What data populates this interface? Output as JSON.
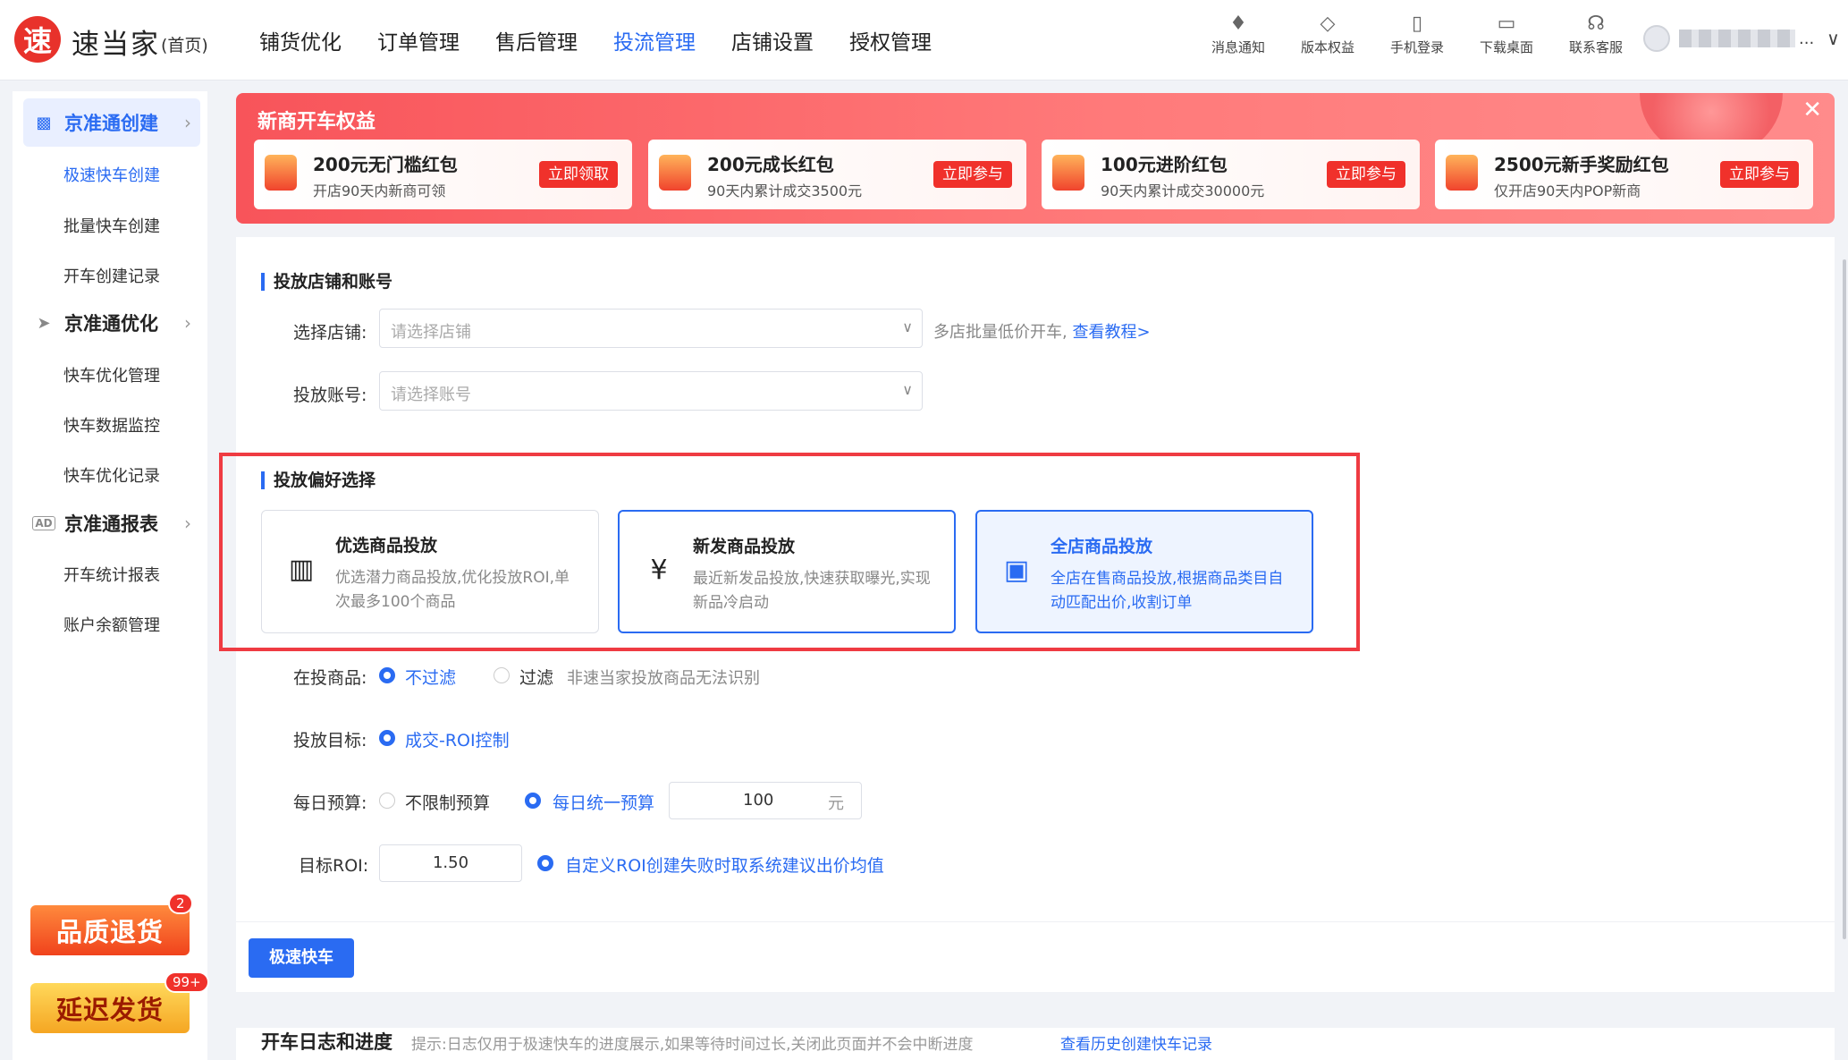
{
  "header": {
    "logo_char": "速",
    "brand": "速当家",
    "brand_sub": "(首页)",
    "nav": [
      {
        "label": "铺货优化"
      },
      {
        "label": "订单管理"
      },
      {
        "label": "售后管理"
      },
      {
        "label": "投流管理",
        "active": true
      },
      {
        "label": "店铺设置"
      },
      {
        "label": "授权管理"
      }
    ],
    "tools": [
      {
        "icon": "bell-icon",
        "glyph": "🔔",
        "label": "消息通知"
      },
      {
        "icon": "diamond-icon",
        "glyph": "◇",
        "label": "版本权益"
      },
      {
        "icon": "phone-icon",
        "glyph": "▯",
        "label": "手机登录"
      },
      {
        "icon": "monitor-icon",
        "glyph": "▭",
        "label": "下载桌面"
      },
      {
        "icon": "headset-icon",
        "glyph": "☊",
        "label": "联系客服"
      }
    ],
    "user": {
      "dots": "...",
      "caret": "∨"
    }
  },
  "sidebar": {
    "groups": [
      {
        "label": "京准通创建",
        "icon": "chart-icon",
        "glyph": "▟",
        "active": true,
        "chevron": "›"
      },
      {
        "label": "京准通优化",
        "icon": "send-icon",
        "glyph": "➤",
        "chevron": "›"
      },
      {
        "label": "京准通报表",
        "icon": "ad-icon",
        "glyph": "AD",
        "chevron": "›"
      }
    ],
    "items": [
      {
        "label": "极速快车创建",
        "active": true
      },
      {
        "label": "批量快车创建"
      },
      {
        "label": "开车创建记录"
      },
      {
        "label": "快车优化管理"
      },
      {
        "label": "快车数据监控"
      },
      {
        "label": "快车优化记录"
      },
      {
        "label": "开车统计报表"
      },
      {
        "label": "账户余额管理"
      }
    ],
    "badges": [
      {
        "label": "品质退货",
        "count": "2"
      },
      {
        "label": "延迟发货",
        "count": "99+"
      }
    ]
  },
  "banner": {
    "title": "新商开车权益",
    "close": "✕",
    "cards": [
      {
        "title": "200元无门槛红包",
        "sub": "开店90天内新商可领",
        "btn": "立即领取"
      },
      {
        "title": "200元成长红包",
        "sub": "90天内累计成交3500元",
        "btn": "立即参与"
      },
      {
        "title": "100元进阶红包",
        "sub": "90天内累计成交30000元",
        "btn": "立即参与"
      },
      {
        "title": "2500元新手奖励红包",
        "sub": "仅开店90天内POP新商",
        "btn": "立即参与"
      }
    ]
  },
  "form": {
    "section1": "投放店铺和账号",
    "shop_label": "选择店铺:",
    "shop_placeholder": "请选择店铺",
    "shop_hint": "多店批量低价开车,",
    "shop_link": "查看教程>",
    "account_label": "投放账号:",
    "account_placeholder": "请选择账号",
    "section2": "投放偏好选择",
    "prefs": [
      {
        "title": "优选商品投放",
        "desc": "优选潜力商品投放,优化投放ROI,单次最多100个商品",
        "icon": "bar-chart-icon",
        "glyph": "📶"
      },
      {
        "title": "新发商品投放",
        "desc": "最近新发品投放,快速获取曝光,实现新品冷启动",
        "icon": "calendar-yen-icon",
        "glyph": "📅"
      },
      {
        "title": "全店商品投放",
        "desc": "全店在售商品投放,根据商品类目自动匹配出价,收割订单",
        "icon": "bag-icon",
        "glyph": "👜"
      }
    ],
    "on_sale_label": "在投商品:",
    "on_sale_opt1": "不过滤",
    "on_sale_opt2": "过滤",
    "on_sale_hint": "非速当家投放商品无法识别",
    "goal_label": "投放目标:",
    "goal_opt": "成交-ROI控制",
    "budget_label": "每日预算:",
    "budget_opt1": "不限制预算",
    "budget_opt2": "每日统一预算",
    "budget_value": "100",
    "budget_unit": "元",
    "roi_label": "目标ROI:",
    "roi_value": "1.50",
    "roi_opt": "自定义ROI创建失败时取系统建议出价均值",
    "submit": "极速快车"
  },
  "log": {
    "title": "开车日志和进度",
    "hint": "提示:日志仅用于极速快车的进度展示,如果等待时间过长,关闭此页面并不会中断进度",
    "link": "查看历史创建快车记录"
  }
}
